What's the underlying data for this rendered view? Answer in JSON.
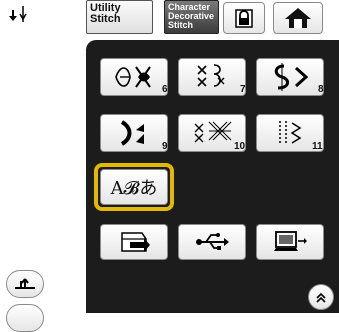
{
  "tabs": {
    "utility": [
      "Utility",
      "Stitch"
    ],
    "character": [
      "Character",
      "Decorative",
      "Stitch"
    ]
  },
  "categories": [
    {
      "number": "6",
      "icon": "floral-stitch-icon"
    },
    {
      "number": "7",
      "icon": "cross-stitch-icon"
    },
    {
      "number": "8",
      "icon": "satin-stitch-icon"
    },
    {
      "number": "9",
      "icon": "decorative-satin-icon"
    },
    {
      "number": "10",
      "icon": "heirloom-cross-icon"
    },
    {
      "number": "11",
      "icon": "satin-blocks-icon"
    }
  ],
  "character_button_label": "A𝓑あ",
  "icons": {
    "top_left": "needle-position-icon",
    "lock": "lock-icon",
    "home": "home-icon",
    "pocket": "pocket-icon",
    "usb": "usb-icon",
    "computer": "computer-icon",
    "presser_foot": "presser-foot-icon",
    "scroll_up": "chevron-up-icon"
  },
  "colors": {
    "highlight": "#e3b800",
    "panel": "#1c1c1c"
  }
}
